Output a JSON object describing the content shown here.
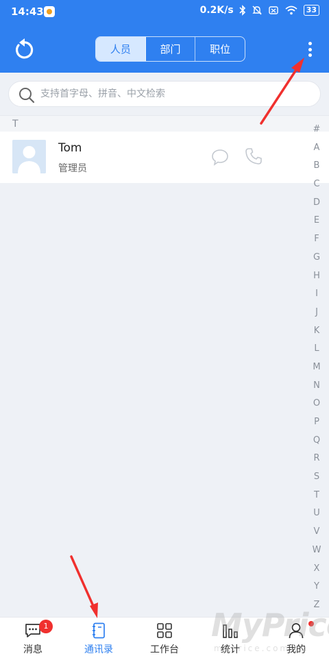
{
  "status_bar": {
    "time": "14:43",
    "network_speed": "0.2K/s",
    "battery": "33",
    "icons": [
      "app-notification-icon",
      "bluetooth-icon",
      "mute-icon",
      "sim-icon",
      "wifi-icon",
      "battery-icon"
    ]
  },
  "header": {
    "refresh_icon": "refresh-icon",
    "tabs": [
      {
        "label": "人员",
        "active": true
      },
      {
        "label": "部门",
        "active": false
      },
      {
        "label": "职位",
        "active": false
      }
    ],
    "more_icon": "more-vertical-icon"
  },
  "search": {
    "placeholder": "支持首字母、拼音、中文检索",
    "value": ""
  },
  "contacts": {
    "section_letter": "T",
    "items": [
      {
        "name": "Tom",
        "role": "管理员",
        "actions": [
          "chat-icon",
          "phone-icon"
        ]
      }
    ]
  },
  "alpha_index": [
    "#",
    "A",
    "B",
    "C",
    "D",
    "E",
    "F",
    "G",
    "H",
    "I",
    "J",
    "K",
    "L",
    "M",
    "N",
    "O",
    "P",
    "Q",
    "R",
    "S",
    "T",
    "U",
    "V",
    "W",
    "X",
    "Y",
    "Z"
  ],
  "bottom_nav": {
    "items": [
      {
        "label": "消息",
        "icon": "message-icon",
        "badge": "1",
        "active": false
      },
      {
        "label": "通讯录",
        "icon": "contacts-book-icon",
        "active": true
      },
      {
        "label": "工作台",
        "icon": "grid-icon",
        "active": false
      },
      {
        "label": "统计",
        "icon": "bar-chart-icon",
        "active": false
      },
      {
        "label": "我的",
        "icon": "user-icon",
        "dot": true,
        "active": false
      }
    ]
  },
  "watermark": {
    "title": "MyPrice",
    "url": "myprice.com.cn"
  },
  "colors": {
    "primary": "#2f80f0",
    "background": "#eef1f6",
    "badge": "#f0302e",
    "annotation_arrow": "#f0302e"
  }
}
